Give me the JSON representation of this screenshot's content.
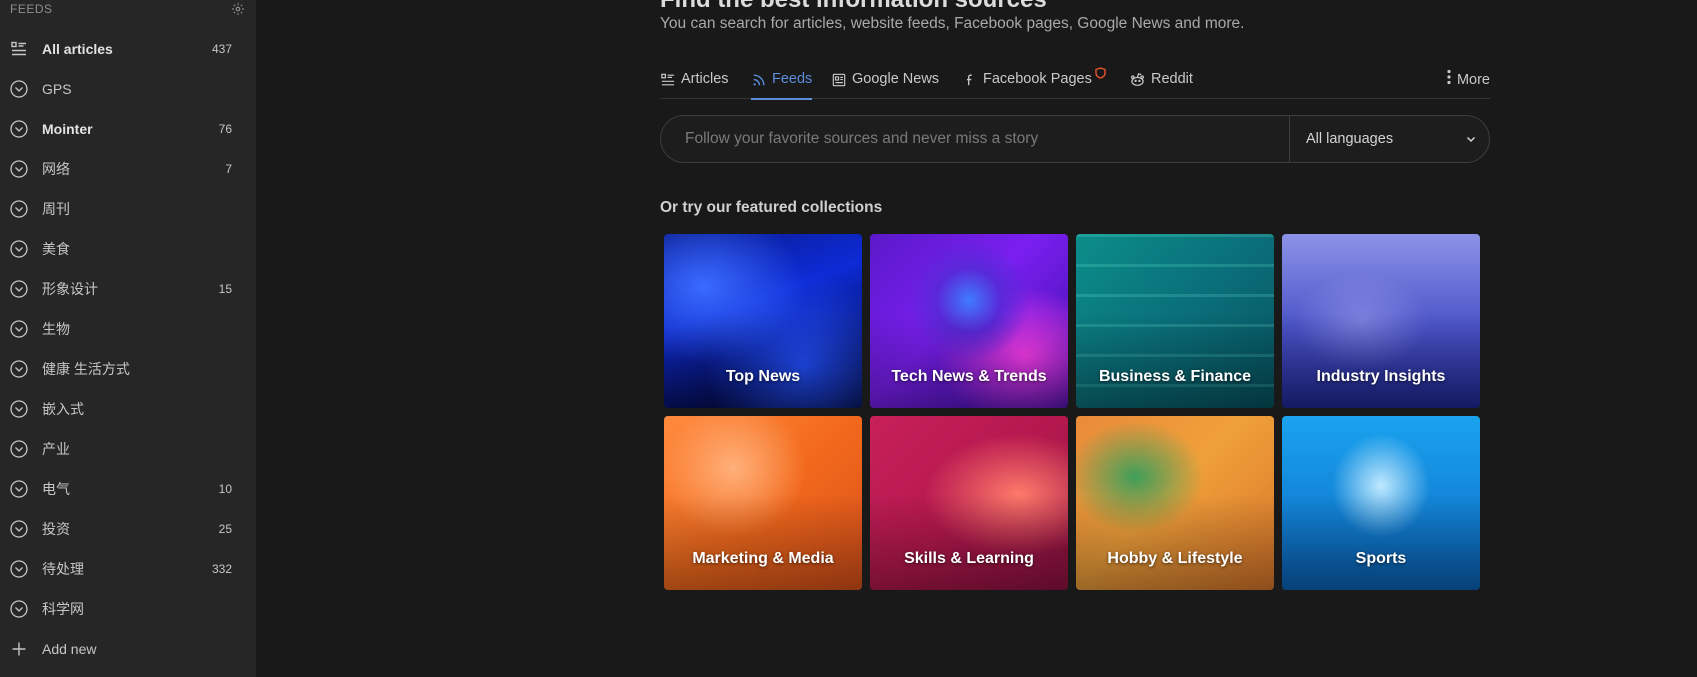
{
  "sidebar": {
    "header_label": "FEEDS",
    "items": [
      {
        "label": "All articles",
        "count": "437",
        "bold": true,
        "icon": "list-icon"
      },
      {
        "label": "GPS",
        "count": "",
        "bold": false,
        "icon": "chevron-circle-icon"
      },
      {
        "label": "Mointer",
        "count": "76",
        "bold": true,
        "icon": "chevron-circle-icon"
      },
      {
        "label": "网络",
        "count": "7",
        "bold": false,
        "icon": "chevron-circle-icon"
      },
      {
        "label": "周刊",
        "count": "",
        "bold": false,
        "icon": "chevron-circle-icon"
      },
      {
        "label": "美食",
        "count": "",
        "bold": false,
        "icon": "chevron-circle-icon"
      },
      {
        "label": "形象设计",
        "count": "15",
        "bold": false,
        "icon": "chevron-circle-icon"
      },
      {
        "label": "生物",
        "count": "",
        "bold": false,
        "icon": "chevron-circle-icon"
      },
      {
        "label": "健康 生活方式",
        "count": "",
        "bold": false,
        "icon": "chevron-circle-icon"
      },
      {
        "label": "嵌入式",
        "count": "",
        "bold": false,
        "icon": "chevron-circle-icon"
      },
      {
        "label": "产业",
        "count": "",
        "bold": false,
        "icon": "chevron-circle-icon"
      },
      {
        "label": "电气",
        "count": "10",
        "bold": false,
        "icon": "chevron-circle-icon"
      },
      {
        "label": "投资",
        "count": "25",
        "bold": false,
        "icon": "chevron-circle-icon"
      },
      {
        "label": "待处理",
        "count": "332",
        "bold": false,
        "icon": "chevron-circle-icon"
      },
      {
        "label": "科学网",
        "count": "",
        "bold": false,
        "icon": "chevron-circle-icon"
      },
      {
        "label": "Add new",
        "count": "",
        "bold": false,
        "icon": "plus-icon"
      }
    ]
  },
  "main": {
    "title": "Find the best information sources",
    "subtitle": "You can search for articles, website feeds, Facebook pages, Google News and more.",
    "tabs": [
      {
        "label": "Articles",
        "icon": "articles-icon",
        "active": false
      },
      {
        "label": "Feeds",
        "icon": "rss-icon",
        "active": true
      },
      {
        "label": "Google News",
        "icon": "news-icon",
        "active": false
      },
      {
        "label": "Facebook Pages",
        "icon": "facebook-icon",
        "active": false
      },
      {
        "label": "Reddit",
        "icon": "reddit-icon",
        "active": false
      }
    ],
    "more_label": "More",
    "search": {
      "placeholder": "Follow your favorite sources and never miss a story",
      "language": "All languages"
    },
    "featured_title": "Or try our featured collections",
    "collections": [
      {
        "label": "Top News"
      },
      {
        "label": "Tech News & Trends"
      },
      {
        "label": "Business & Finance"
      },
      {
        "label": "Industry Insights"
      },
      {
        "label": "Marketing & Media"
      },
      {
        "label": "Skills & Learning"
      },
      {
        "label": "Hobby & Lifestyle"
      },
      {
        "label": "Sports"
      }
    ]
  },
  "colors": {
    "background": "#191919",
    "sidebar": "#262626",
    "accent": "#5b8ddb",
    "shield_badge": "#e8542b"
  }
}
